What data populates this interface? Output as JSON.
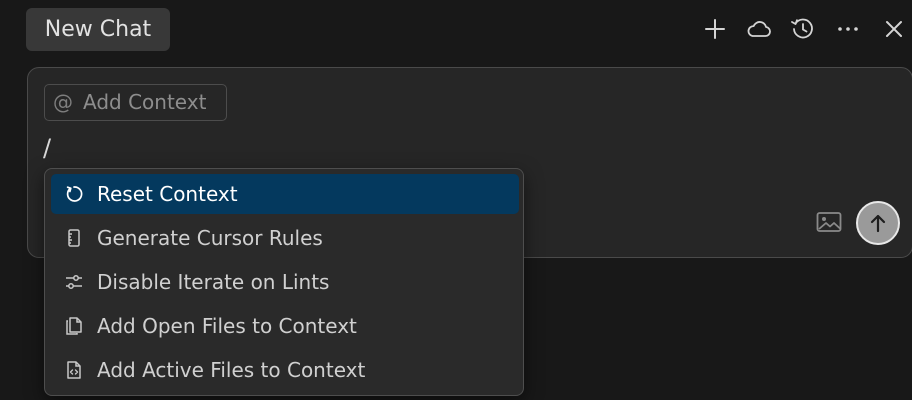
{
  "header": {
    "tab_label": "New Chat",
    "actions": [
      {
        "icon": "plus-icon"
      },
      {
        "icon": "cloud-icon"
      },
      {
        "icon": "history-icon"
      },
      {
        "icon": "more-icon"
      },
      {
        "icon": "close-icon"
      }
    ]
  },
  "composer": {
    "add_context_label": "Add Context",
    "at_symbol": "@",
    "input_text": "/",
    "image_icon": "image-icon",
    "send_icon": "arrow-up-icon"
  },
  "command_menu": {
    "items": [
      {
        "label": "Reset Context",
        "icon": "refresh-icon",
        "active": true
      },
      {
        "label": "Generate Cursor Rules",
        "icon": "ruler-icon",
        "active": false
      },
      {
        "label": "Disable Iterate on Lints",
        "icon": "sliders-icon",
        "active": false
      },
      {
        "label": "Add Open Files to Context",
        "icon": "copy-files-icon",
        "active": false
      },
      {
        "label": "Add Active Files to Context",
        "icon": "code-file-icon",
        "active": false
      }
    ]
  },
  "colors": {
    "background": "#181818",
    "composer_bg": "#262626",
    "menu_bg": "#2a2a2a",
    "active_item": "#04395e",
    "tab_bg": "#383838"
  }
}
